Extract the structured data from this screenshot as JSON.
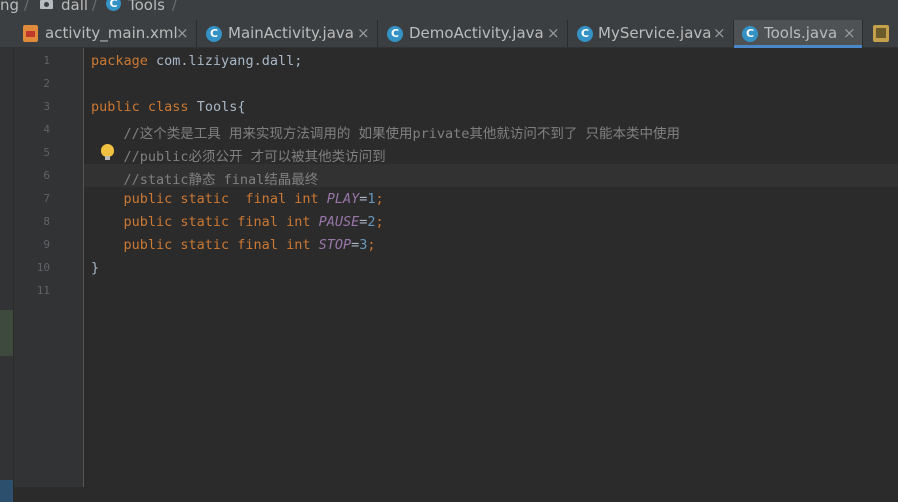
{
  "breadcrumb": {
    "items": [
      "ng",
      "dall",
      "Tools"
    ],
    "separator": "/"
  },
  "tabs": [
    {
      "label": "activity_main.xml",
      "icon": "xml-file-icon",
      "active": false
    },
    {
      "label": "MainActivity.java",
      "icon": "class-icon",
      "active": false
    },
    {
      "label": "DemoActivity.java",
      "icon": "class-icon",
      "active": false
    },
    {
      "label": "MyService.java",
      "icon": "class-icon",
      "active": false
    },
    {
      "label": "Tools.java",
      "icon": "class-icon",
      "active": true
    }
  ],
  "tab_close_glyph": "×",
  "class_icon_letter": "C",
  "gutter": {
    "line_numbers": [
      "1",
      "2",
      "3",
      "4",
      "5",
      "6",
      "7",
      "8",
      "9",
      "10",
      "11"
    ]
  },
  "code": {
    "line1": {
      "kw": "package",
      "rest": " com.liziyang.dall;"
    },
    "line3": {
      "kw1": "public",
      "kw2": "class",
      "rest": " Tools{"
    },
    "line4": "    //这个类是工具 用来实现方法调用的 如果使用private其他就访问不到了 只能本类中使用",
    "line5": "    //public必须公开 才可以被其他类访问到",
    "line6": "    //static静态 final结晶最终",
    "line7": {
      "indent": "    ",
      "kw": "public static  final int",
      "name": "PLAY",
      "eq": "=",
      "val": "1",
      "semi": ";"
    },
    "line8": {
      "indent": "    ",
      "kw": "public static final int",
      "name": "PAUSE",
      "eq": "=",
      "val": "2",
      "semi": ";"
    },
    "line9": {
      "indent": "    ",
      "kw": "public static final int",
      "name": "STOP",
      "eq": "=",
      "val": "3",
      "semi": ";"
    },
    "line10": "}"
  },
  "colors": {
    "keyword": "#cc7832",
    "comment": "#808080",
    "constant": "#9876aa",
    "number": "#6897bb",
    "text": "#a9b7c6",
    "active_tab_underline": "#4a88c7"
  }
}
